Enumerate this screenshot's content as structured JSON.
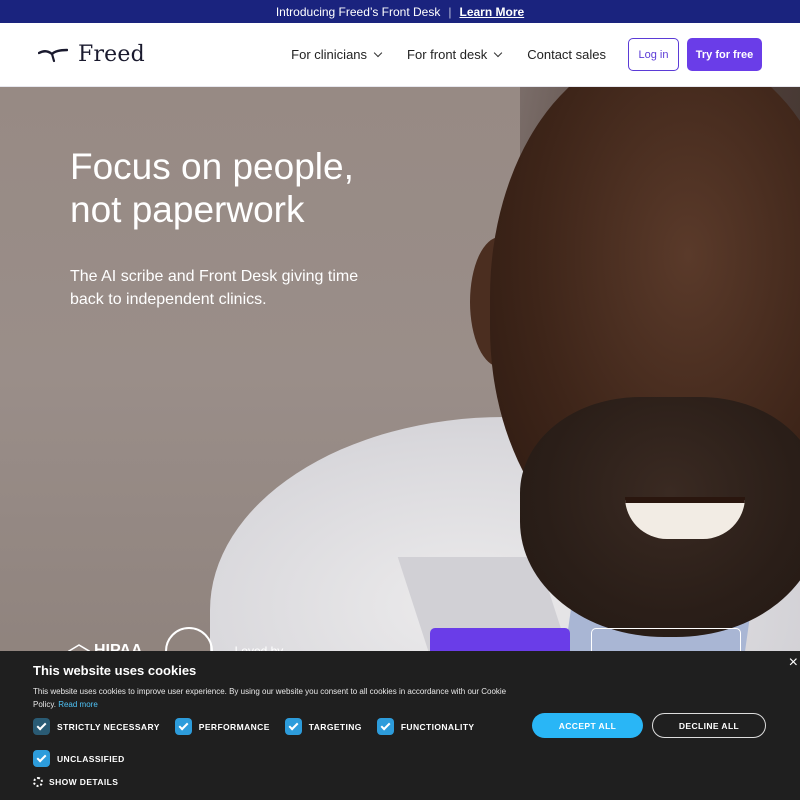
{
  "announcement": {
    "text": "Introducing Freed’s Front Desk",
    "separator": "|",
    "link": "Learn More"
  },
  "nav": {
    "logo_text": "Freed",
    "items": [
      {
        "label": "For clinicians",
        "has_dropdown": true
      },
      {
        "label": "For front desk",
        "has_dropdown": true
      },
      {
        "label": "Contact sales",
        "has_dropdown": false
      }
    ],
    "login_label": "Log in",
    "try_label": "Try for free"
  },
  "hero": {
    "title_line1": "Focus on people,",
    "title_line2": "not paperwork",
    "subtitle": "The AI scribe and Front Desk giving time back to independent clinics.",
    "badges": {
      "hipaa": "HIPAA",
      "loved_by": "Loved by"
    }
  },
  "cookie": {
    "title": "This website uses cookies",
    "text": "This website uses cookies to improve user experience. By using our website you consent to all cookies in accordance with our Cookie Policy.",
    "read_more": "Read more",
    "close": "×",
    "categories": [
      {
        "label": "STRICTLY NECESSARY",
        "checked": true,
        "locked": true
      },
      {
        "label": "PERFORMANCE",
        "checked": true
      },
      {
        "label": "TARGETING",
        "checked": true
      },
      {
        "label": "FUNCTIONALITY",
        "checked": true
      },
      {
        "label": "UNCLASSIFIED",
        "checked": true
      }
    ],
    "show_details": "SHOW DETAILS",
    "accept_all": "ACCEPT ALL",
    "decline_all": "DECLINE ALL"
  },
  "colors": {
    "announcement_bg": "#1a237e",
    "brand_purple": "#6a3de8",
    "cookie_bg": "#1f1f1f",
    "cookie_accent": "#29b6f6"
  }
}
